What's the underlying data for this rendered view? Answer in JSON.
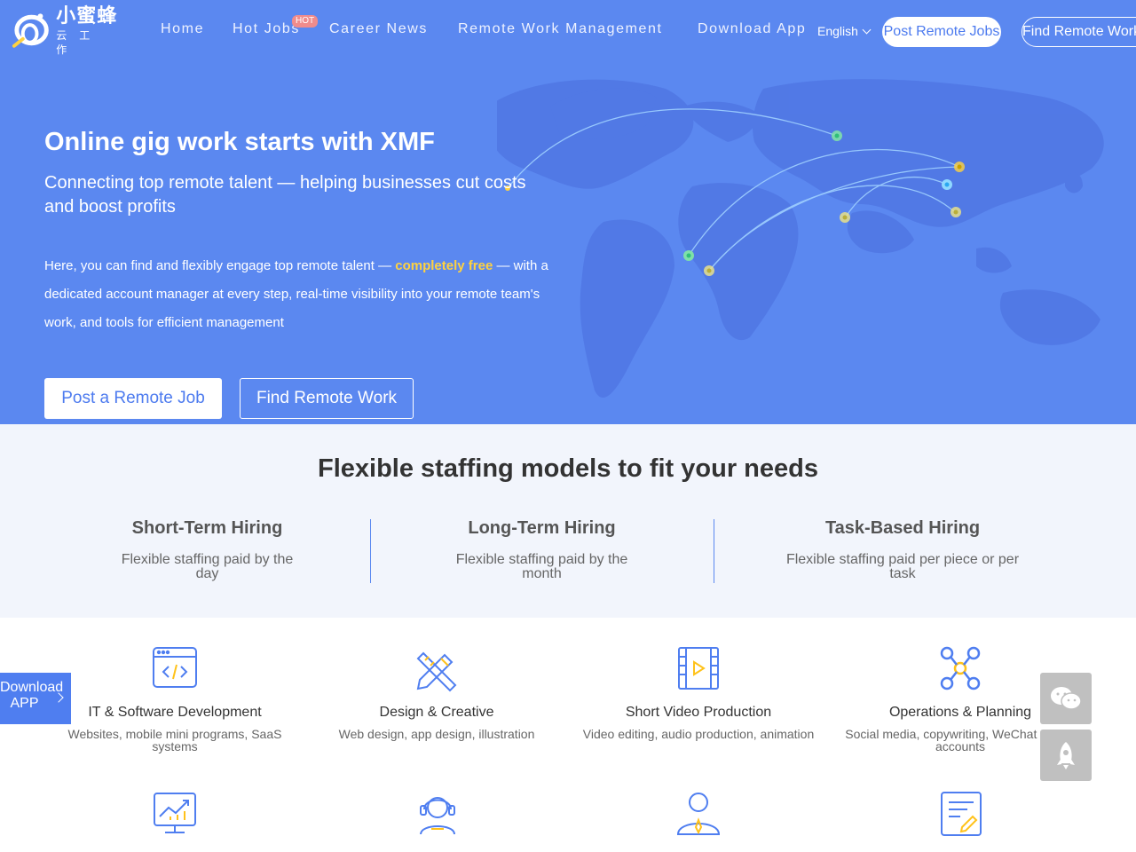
{
  "header": {
    "logo_cn": "小蜜蜂",
    "logo_sub": "云工作",
    "nav": [
      "Home",
      "Hot Jobs",
      "Career News",
      "Remote Work Management",
      "Download App"
    ],
    "hot_badge": "HOT",
    "language": "English",
    "post_button": "Post Remote Jobs",
    "find_button": "Find Remote Work"
  },
  "hero": {
    "title": "Online gig work starts with XMF",
    "subtitle": "Connecting top remote talent — helping businesses cut costs and boost profits",
    "desc_before": "Here, you can find and flexibly engage top remote talent — ",
    "desc_highlight": "completely free",
    "desc_after": " — with a dedicated account manager at every step, real-time visibility into your remote team's work, and tools for efficient management",
    "btn_post": "Post a Remote Job",
    "btn_find": "Find Remote Work"
  },
  "staffing": {
    "title": "Flexible staffing models to fit your needs",
    "models": [
      {
        "name": "Short-Term Hiring",
        "desc": "Flexible staffing paid by the day"
      },
      {
        "name": "Long-Term Hiring",
        "desc": "Flexible staffing paid by the month"
      },
      {
        "name": "Task-Based Hiring",
        "desc": "Flexible staffing paid per piece or per task"
      }
    ]
  },
  "categories": [
    {
      "name": "IT & Software Development",
      "desc": "Websites, mobile mini programs, SaaS systems",
      "icon": "code-window-icon"
    },
    {
      "name": "Design & Creative",
      "desc": "Web design, app design, illustration",
      "icon": "pencil-ruler-icon"
    },
    {
      "name": "Short Video Production",
      "desc": "Video editing, audio production, animation",
      "icon": "video-film-icon"
    },
    {
      "name": "Operations & Planning",
      "desc": "Social media, copywriting, WeChat official accounts",
      "icon": "network-nodes-icon"
    },
    {
      "icon": "chart-monitor-icon"
    },
    {
      "icon": "headset-agent-icon"
    },
    {
      "icon": "business-person-icon"
    },
    {
      "icon": "document-edit-icon"
    }
  ],
  "floating": {
    "download": "Download APP"
  },
  "colors": {
    "hero_bg": "#5b88f0",
    "accent": "#4d7bef",
    "highlight": "#ffd23f",
    "section_bg": "#f2f5fc",
    "float_btn": "#c0c0c0"
  }
}
